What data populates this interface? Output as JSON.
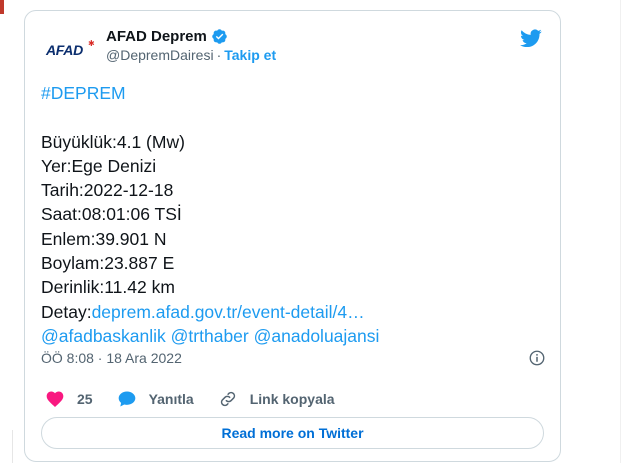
{
  "colors": {
    "accent": "#1d9bf0",
    "like": "#f91880",
    "brand_navy": "#0b2e6e",
    "brand_red": "#d92c27"
  },
  "author": {
    "logo_text": "AFAD",
    "display_name": "AFAD Deprem",
    "handle": "@DepremDairesi",
    "follow_label": "Takip et"
  },
  "tweet": {
    "hashtag": "#DEPREM",
    "lines": [
      "Büyüklük:4.1 (Mw)",
      "Yer:Ege Denizi",
      "Tarih:2022-12-18",
      "Saat:08:01:06 TSİ",
      "Enlem:39.901 N",
      "Boylam:23.887 E",
      "Derinlik:11.42 km"
    ],
    "detail_label": "Detay:",
    "detail_link": "deprem.afad.gov.tr/event-detail/4…",
    "mentions": [
      "@afadbaskanlik",
      "@trthaber",
      "@anadoluajansi"
    ],
    "timestamp": "ÖÖ 8:08 · 18 Ara 2022"
  },
  "actions": {
    "like_count": "25",
    "reply_label": "Yanıtla",
    "copy_link_label": "Link kopyala"
  },
  "read_more_label": "Read more on Twitter",
  "icons": {
    "verified": "verified-badge-icon",
    "twitter": "twitter-bird-icon",
    "info": "info-icon",
    "like": "heart-icon",
    "reply": "speech-bubble-icon",
    "link": "link-icon"
  }
}
